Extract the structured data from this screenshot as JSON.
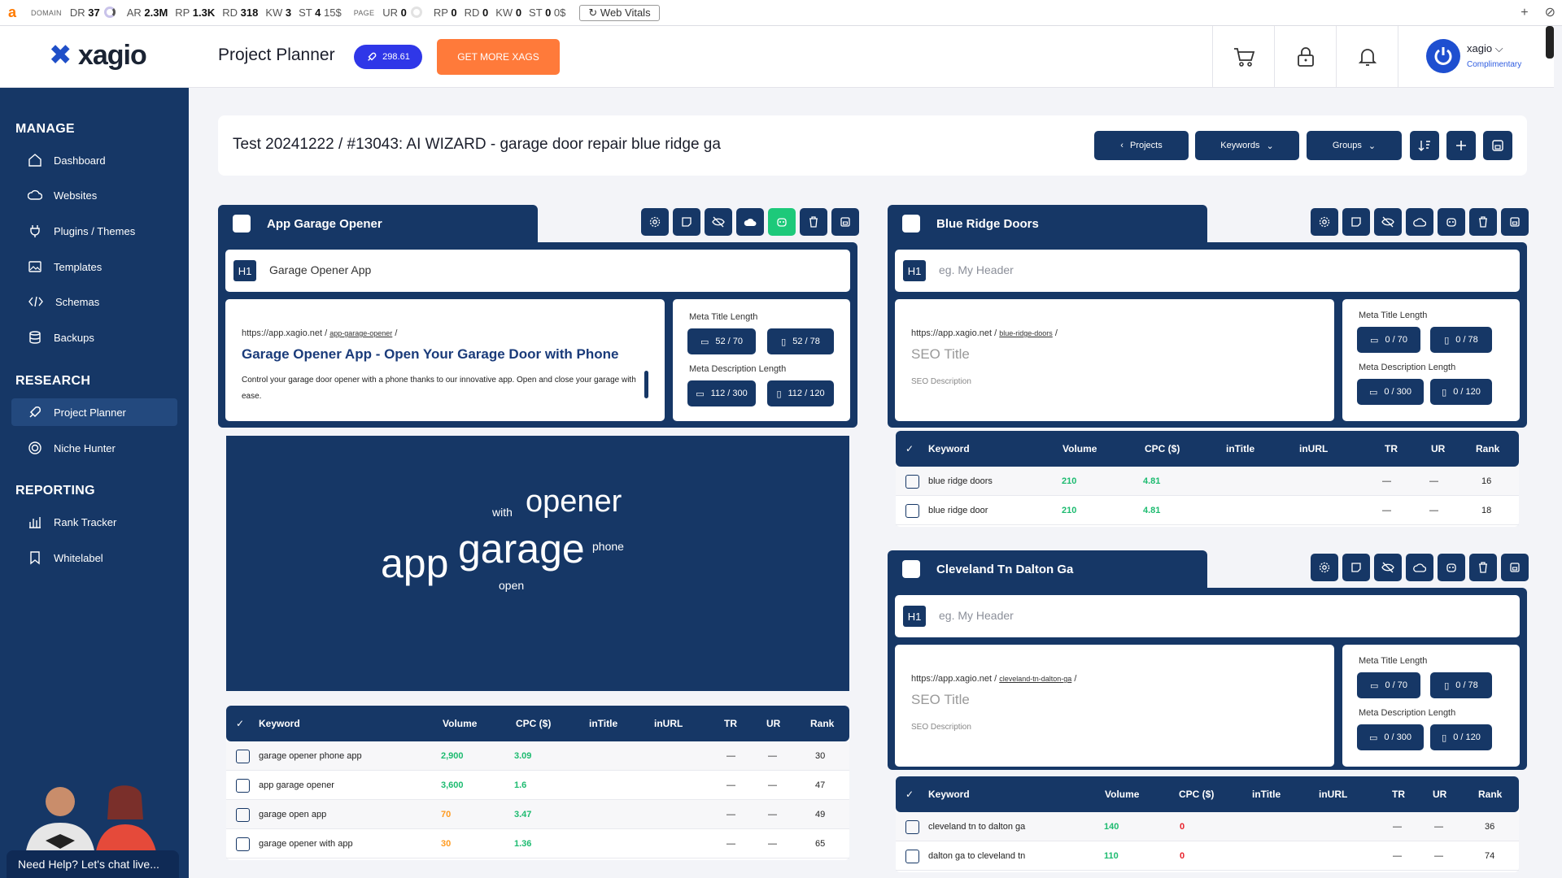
{
  "seobar": {
    "logo": "a",
    "domain_tag": "DOMAIN",
    "domain_metrics": [
      {
        "k": "DR",
        "v": "37"
      },
      {
        "k": "AR",
        "v": "2.3M"
      },
      {
        "k": "RP",
        "v": "1.3K"
      },
      {
        "k": "RD",
        "v": "318"
      },
      {
        "k": "KW",
        "v": "3"
      },
      {
        "k": "ST",
        "v": "4"
      }
    ],
    "domain_price": "15$",
    "page_tag": "PAGE",
    "page_metrics": [
      {
        "k": "UR",
        "v": "0"
      },
      {
        "k": "RP",
        "v": "0"
      },
      {
        "k": "RD",
        "v": "0"
      },
      {
        "k": "KW",
        "v": "0"
      },
      {
        "k": "ST",
        "v": "0"
      }
    ],
    "page_price": "0$",
    "web_vitals": "Web Vitals"
  },
  "header": {
    "brand": "xagio",
    "page_title": "Project Planner",
    "xags_balance": "298.61",
    "get_more": "GET MORE XAGS",
    "user_name": "xagio",
    "user_plan": "Complimentary"
  },
  "sidebar": {
    "sections": [
      {
        "title": "MANAGE",
        "items": [
          "Dashboard",
          "Websites",
          "Plugins / Themes",
          "Templates",
          "Schemas",
          "Backups"
        ]
      },
      {
        "title": "RESEARCH",
        "items": [
          "Project Planner",
          "Niche Hunter"
        ]
      },
      {
        "title": "REPORTING",
        "items": [
          "Rank Tracker",
          "Whitelabel"
        ]
      }
    ],
    "help": "Need Help? Let's chat live..."
  },
  "titlebar": {
    "title": "Test 20241222 / #13043: AI WIZARD - garage door repair blue ridge ga",
    "projects": "Projects",
    "keywords": "Keywords",
    "groups": "Groups"
  },
  "columns": [
    "Keyword",
    "Volume",
    "CPC ($)",
    "inTitle",
    "inURL",
    "TR",
    "UR",
    "Rank"
  ],
  "labels": {
    "meta_title_length": "Meta Title Length",
    "meta_desc_length": "Meta Description Length",
    "url_base": "https://app.xagio.net",
    "h1": "H1",
    "seo_title_ph": "SEO Title",
    "seo_desc_ph": "SEO Description",
    "header_ph": "eg. My Header"
  },
  "groups": [
    {
      "name": "App Garage Opener",
      "h1": "Garage Opener App",
      "slug": "app-garage-opener",
      "seo_title": "Garage Opener App - Open Your Garage Door with Phone",
      "seo_desc": "Control your garage door opener with a phone thanks to our innovative app. Open and close your garage with ease.",
      "title_desktop": "52 / 70",
      "title_mobile": "52 / 78",
      "desc_desktop": "112 / 300",
      "desc_mobile": "112 / 120",
      "cloud_words": [
        "with",
        "opener",
        "app",
        "garage",
        "phone",
        "open"
      ],
      "keywords": [
        {
          "kw": "garage opener phone app",
          "vol": "2,900",
          "vol_color": "green",
          "cpc": "3.09",
          "tr": "—",
          "ur": "—",
          "rank": "30"
        },
        {
          "kw": "app garage opener",
          "vol": "3,600",
          "vol_color": "green",
          "cpc": "1.6",
          "tr": "—",
          "ur": "—",
          "rank": "47"
        },
        {
          "kw": "garage open app",
          "vol": "70",
          "vol_color": "orange",
          "cpc": "3.47",
          "tr": "—",
          "ur": "—",
          "rank": "49"
        },
        {
          "kw": "garage opener with app",
          "vol": "30",
          "vol_color": "orange",
          "cpc": "1.36",
          "tr": "—",
          "ur": "—",
          "rank": "65"
        }
      ]
    },
    {
      "name": "Blue Ridge Doors",
      "slug": "blue-ridge-doors",
      "title_desktop": "0 / 70",
      "title_mobile": "0 / 78",
      "desc_desktop": "0 / 300",
      "desc_mobile": "0 / 120",
      "keywords": [
        {
          "kw": "blue ridge doors",
          "vol": "210",
          "cpc": "4.81",
          "tr": "—",
          "ur": "—",
          "rank": "16"
        },
        {
          "kw": "blue ridge door",
          "vol": "210",
          "cpc": "4.81",
          "tr": "—",
          "ur": "—",
          "rank": "18"
        }
      ]
    },
    {
      "name": "Cleveland Tn Dalton Ga",
      "slug": "cleveland-tn-dalton-ga",
      "title_desktop": "0 / 70",
      "title_mobile": "0 / 78",
      "desc_desktop": "0 / 300",
      "desc_mobile": "0 / 120",
      "keywords": [
        {
          "kw": "cleveland tn to dalton ga",
          "vol": "140",
          "cpc": "0",
          "tr": "—",
          "ur": "—",
          "rank": "36"
        },
        {
          "kw": "dalton ga to cleveland tn",
          "vol": "110",
          "cpc": "0",
          "tr": "—",
          "ur": "—",
          "rank": "74"
        }
      ]
    }
  ],
  "colors": {
    "navy": "#163766",
    "accent_green": "#1dc97a",
    "orange": "#ff7a3a",
    "blue": "#2f37e8"
  }
}
